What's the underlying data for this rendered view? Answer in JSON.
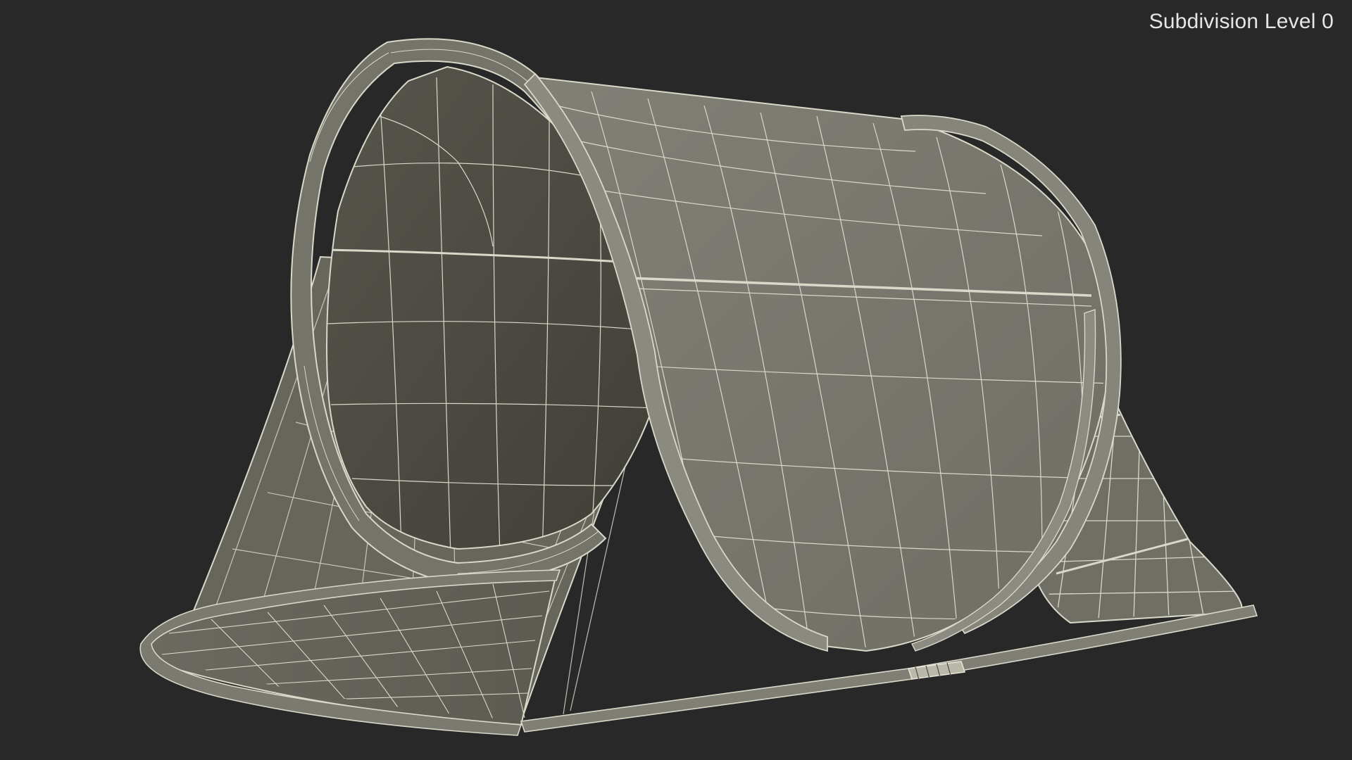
{
  "viewport": {
    "overlay_label": "Subdivision Level 0",
    "background_color": "#282828",
    "subject": "tent-wireframe-model",
    "colors": {
      "surface_light": "#7b7b72",
      "surface_mid": "#6c6c63",
      "surface_dark": "#45453d",
      "wire": "#d9d8c9"
    }
  }
}
